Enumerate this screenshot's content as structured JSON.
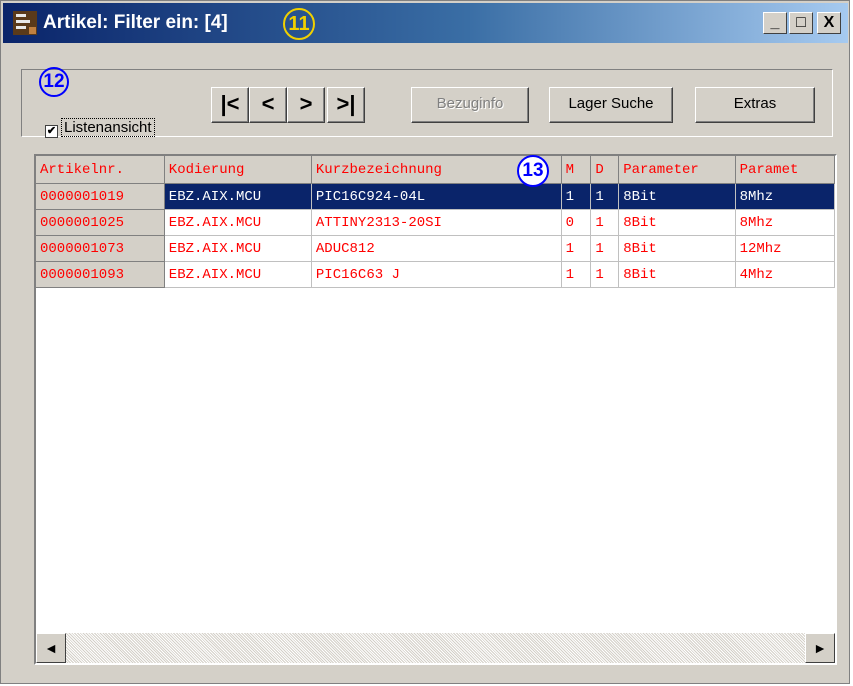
{
  "window": {
    "title": "Artikel: Filter ein:  [4]",
    "minimize_glyph": "_",
    "maximize_glyph": "□",
    "close_glyph": "X"
  },
  "annotations": {
    "title_marker": "11",
    "toolbar_marker": "12",
    "grid_marker": "13"
  },
  "toolbar": {
    "list_view_label": "Listenansicht",
    "list_view_checked": true,
    "nav_first": "|<",
    "nav_prev": "<",
    "nav_next": ">",
    "nav_last": ">|",
    "bezuginfo_label": "Bezuginfo",
    "lager_suche_label": "Lager Suche",
    "extras_label": "Extras"
  },
  "grid": {
    "columns": [
      "Artikelnr.",
      "Kodierung",
      "Kurzbezeichnung",
      "M",
      "D",
      "Parameter",
      "Paramet"
    ],
    "rows": [
      [
        "0000001019",
        "EBZ.AIX.MCU",
        "PIC16C924-04L",
        "1",
        "1",
        "8Bit",
        "8Mhz"
      ],
      [
        "0000001025",
        "EBZ.AIX.MCU",
        "ATTINY2313-20SI",
        "0",
        "1",
        "8Bit",
        "8Mhz"
      ],
      [
        "0000001073",
        "EBZ.AIX.MCU",
        "ADUC812",
        "1",
        "1",
        "8Bit",
        "12Mhz"
      ],
      [
        "0000001093",
        "EBZ.AIX.MCU",
        "PIC16C63 J",
        "1",
        "1",
        "8Bit",
        "4Mhz"
      ]
    ],
    "selected_row": 0
  },
  "scrollbar": {
    "left_arrow": "◄",
    "right_arrow": "►"
  },
  "colors": {
    "title_gradient_start": "#0a246a",
    "header_text": "#ff0000",
    "selection_bg": "#0a246a",
    "marker_yellow": "#f0d000",
    "marker_blue": "#0000ff"
  }
}
